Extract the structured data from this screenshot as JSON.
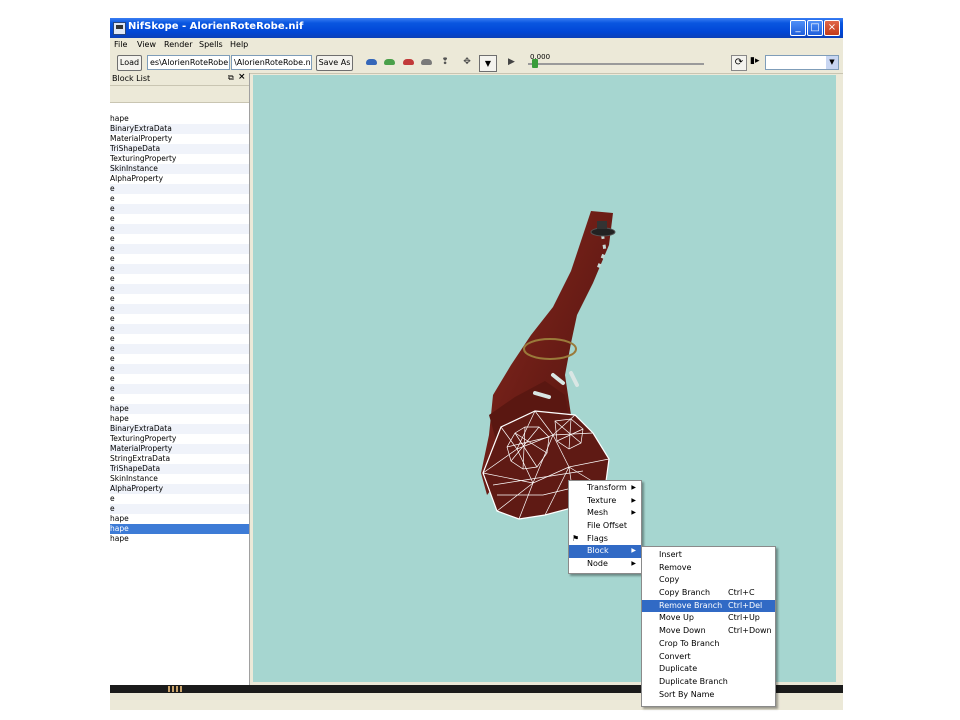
{
  "window": {
    "title": "NifSkope - AlorienRoteRobe.nif",
    "buttons": {
      "minimize": "_",
      "maximize": "□",
      "close": "×"
    }
  },
  "menubar": {
    "items": [
      "File",
      "View",
      "Render",
      "Spells",
      "Help"
    ]
  },
  "toolbar": {
    "load_label": "Load",
    "load_path": "es\\AlorienRoteRobe.nif",
    "save_path": "\\AlorienRoteRobe.nif",
    "save_as_label": "Save As",
    "time_value": "0.000",
    "time_fraction": 0.0
  },
  "block_list": {
    "title": "Block List",
    "rows": [
      "hape",
      "BinaryExtraData",
      "MaterialProperty",
      "TriShapeData",
      "TexturingProperty",
      "SkinInstance",
      "AlphaProperty",
      "e",
      "e",
      "e",
      "e",
      "e",
      "e",
      "e",
      "e",
      "e",
      "e",
      "e",
      "e",
      "e",
      "e",
      "e",
      "e",
      "e",
      "e",
      "e",
      "e",
      "e",
      "e",
      "hape",
      "hape",
      "BinaryExtraData",
      "TexturingProperty",
      "MaterialProperty",
      "StringExtraData",
      "TriShapeData",
      "SkinInstance",
      "AlphaProperty",
      "e",
      "e",
      "hape",
      "hape",
      "hape"
    ],
    "selected_index": 41
  },
  "context_menu": {
    "items": [
      {
        "label": "Transform",
        "submenu": true
      },
      {
        "label": "Texture",
        "submenu": true
      },
      {
        "label": "Mesh",
        "submenu": true
      },
      {
        "label": "File Offset",
        "submenu": false
      },
      {
        "label": "Flags",
        "submenu": false
      },
      {
        "label": "Block",
        "submenu": true
      },
      {
        "label": "Node",
        "submenu": true
      }
    ],
    "highlighted_index": 5
  },
  "block_submenu": {
    "items": [
      {
        "label": "Insert",
        "shortcut": ""
      },
      {
        "label": "Remove",
        "shortcut": ""
      },
      {
        "label": "Copy",
        "shortcut": ""
      },
      {
        "label": "Copy Branch",
        "shortcut": "Ctrl+C"
      },
      {
        "label": "Remove Branch",
        "shortcut": "Ctrl+Del"
      },
      {
        "label": "Move Up",
        "shortcut": "Ctrl+Up"
      },
      {
        "label": "Move Down",
        "shortcut": "Ctrl+Down"
      },
      {
        "label": "Crop To Branch",
        "shortcut": ""
      },
      {
        "label": "Convert",
        "shortcut": ""
      },
      {
        "label": "Duplicate",
        "shortcut": ""
      },
      {
        "label": "Duplicate Branch",
        "shortcut": ""
      },
      {
        "label": "Sort By Name",
        "shortcut": ""
      }
    ],
    "highlighted_index": 4
  },
  "colors": {
    "viewport_bg": "#a6d6d0",
    "selection": "#316ac5",
    "robe": "#6e1c15",
    "wireframe": "#ffffff"
  }
}
